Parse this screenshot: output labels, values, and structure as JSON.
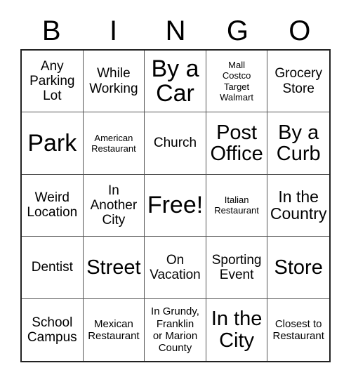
{
  "card": {
    "header_letters": [
      "B",
      "I",
      "N",
      "G",
      "O"
    ],
    "columns": 5,
    "rows": 5,
    "colors": {
      "background": "#ffffff",
      "text": "#000000",
      "outer_border": "#222222",
      "grid_line": "#555555"
    },
    "cells": [
      {
        "text": "Any\nParking\nLot",
        "size": "m"
      },
      {
        "text": "While\nWorking",
        "size": "m"
      },
      {
        "text": "By a\nCar",
        "size": "xxl"
      },
      {
        "text": "Mall\nCostco\nTarget\nWalmart",
        "size": "xs"
      },
      {
        "text": "Grocery\nStore",
        "size": "m"
      },
      {
        "text": "Park",
        "size": "xxl"
      },
      {
        "text": "American\nRestaurant",
        "size": "xs"
      },
      {
        "text": "Church",
        "size": "m"
      },
      {
        "text": "Post\nOffice",
        "size": "xl"
      },
      {
        "text": "By a\nCurb",
        "size": "xl"
      },
      {
        "text": "Weird\nLocation",
        "size": "m"
      },
      {
        "text": "In\nAnother\nCity",
        "size": "m"
      },
      {
        "text": "Free!",
        "size": "xxl"
      },
      {
        "text": "Italian\nRestaurant",
        "size": "xs"
      },
      {
        "text": "In the\nCountry",
        "size": "l"
      },
      {
        "text": "Dentist",
        "size": "m"
      },
      {
        "text": "Street",
        "size": "xl"
      },
      {
        "text": "On\nVacation",
        "size": "m"
      },
      {
        "text": "Sporting\nEvent",
        "size": "m"
      },
      {
        "text": "Store",
        "size": "xl"
      },
      {
        "text": "School\nCampus",
        "size": "m"
      },
      {
        "text": "Mexican\nRestaurant",
        "size": "s"
      },
      {
        "text": "In Grundy,\nFranklin\nor Marion\nCounty",
        "size": "s"
      },
      {
        "text": "In the\nCity",
        "size": "xl"
      },
      {
        "text": "Closest to\nRestaurant",
        "size": "s"
      }
    ]
  }
}
